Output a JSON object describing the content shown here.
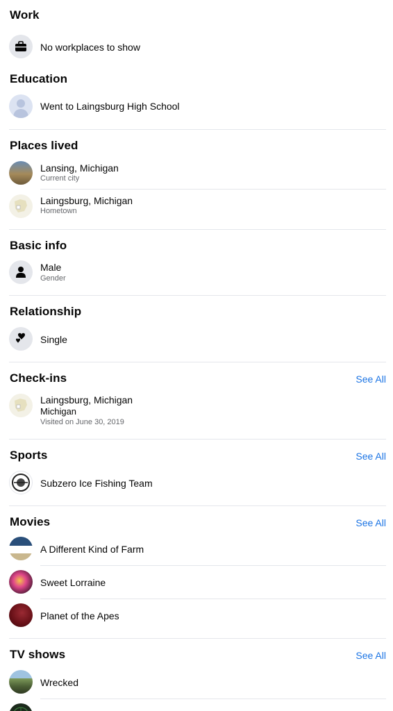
{
  "work": {
    "title": "Work",
    "item": "No workplaces to show",
    "icon": "briefcase-icon"
  },
  "education": {
    "title": "Education",
    "item": "Went to Laingsburg High School",
    "icon": "school-icon"
  },
  "places_lived": {
    "title": "Places lived",
    "items": [
      {
        "name": "Lansing, Michigan",
        "sub": "Current city",
        "icon": "city-photo"
      },
      {
        "name": "Laingsburg, Michigan",
        "sub": "Hometown",
        "icon": "map-icon"
      }
    ]
  },
  "basic_info": {
    "title": "Basic info",
    "value": "Male",
    "label": "Gender",
    "icon": "person-icon"
  },
  "relationship": {
    "title": "Relationship",
    "value": "Single",
    "icon": "hearts-icon"
  },
  "checkins": {
    "title": "Check-ins",
    "see_all": "See All",
    "item": {
      "name": "Laingsburg, Michigan",
      "region": "Michigan",
      "date": "Visited on June 30, 2019",
      "icon": "map-icon"
    }
  },
  "sports": {
    "title": "Sports",
    "see_all": "See All",
    "item": "Subzero Ice Fishing Team",
    "icon": "team-logo"
  },
  "movies": {
    "title": "Movies",
    "see_all": "See All",
    "items": [
      {
        "name": "A Different Kind of Farm",
        "icon": "movie-thumb-1"
      },
      {
        "name": "Sweet Lorraine",
        "icon": "movie-thumb-2"
      },
      {
        "name": "Planet of the Apes",
        "icon": "movie-thumb-3"
      }
    ]
  },
  "tv_shows": {
    "title": "TV shows",
    "see_all": "See All",
    "items": [
      {
        "name": "Wrecked",
        "icon": "tv-thumb-1"
      }
    ]
  },
  "colors": {
    "accent": "#1b74e4",
    "text": "#050505",
    "secondary": "#65676b",
    "divider": "#e4e6eb",
    "icon_bg": "#e4e6eb"
  }
}
